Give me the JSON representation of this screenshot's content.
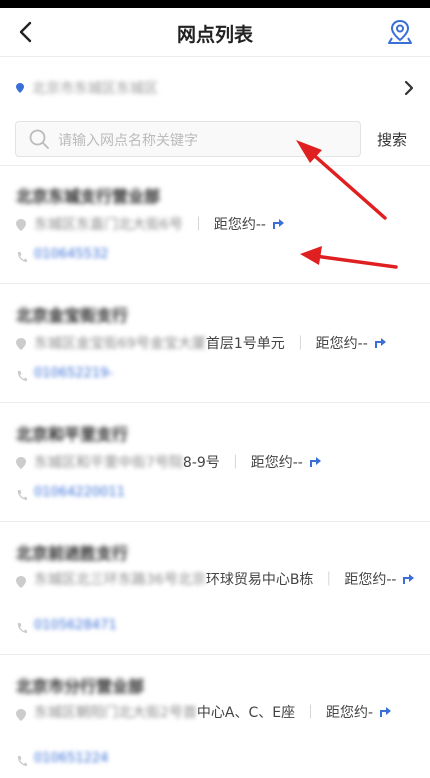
{
  "header": {
    "title": "网点列表",
    "back_icon": "chevron-left-icon",
    "map_icon": "map-pin-icon"
  },
  "region": {
    "text": "北京市东城区东城区"
  },
  "search": {
    "placeholder": "请输入网点名称关键字",
    "button_label": "搜索"
  },
  "branches": [
    {
      "name": "北京东城支行营业部",
      "address": "东城区东直门北大街6号",
      "separator": "｜",
      "distance": "距您约--",
      "phone": "010645532"
    },
    {
      "name": "北京金宝街支行",
      "address": "东城区金宝街69号金宝大厦",
      "address_visible": "首层1号单元",
      "separator": "｜",
      "distance": "距您约--",
      "phone": "010652219-"
    },
    {
      "name": "北京和平里支行",
      "address": "东城区和平里中街7号院",
      "address_visible": "8-9号",
      "separator": "｜",
      "distance": "距您约--",
      "phone": "01064220011"
    },
    {
      "name": "北京前进胜支行",
      "address": "东城区北三环东路36号北京",
      "address_visible": "环球贸易中心B栋",
      "separator": "｜",
      "distance": "距您约--",
      "phone": "0105628471"
    },
    {
      "name": "北京市分行营业部",
      "address": "东城区朝阳门北大街2号首",
      "address_visible": "中心A、C、E座",
      "separator": "｜",
      "distance": "距您约-",
      "phone": "010651224"
    }
  ],
  "colors": {
    "accent": "#3a6fd8",
    "arrow": "#e02020"
  }
}
